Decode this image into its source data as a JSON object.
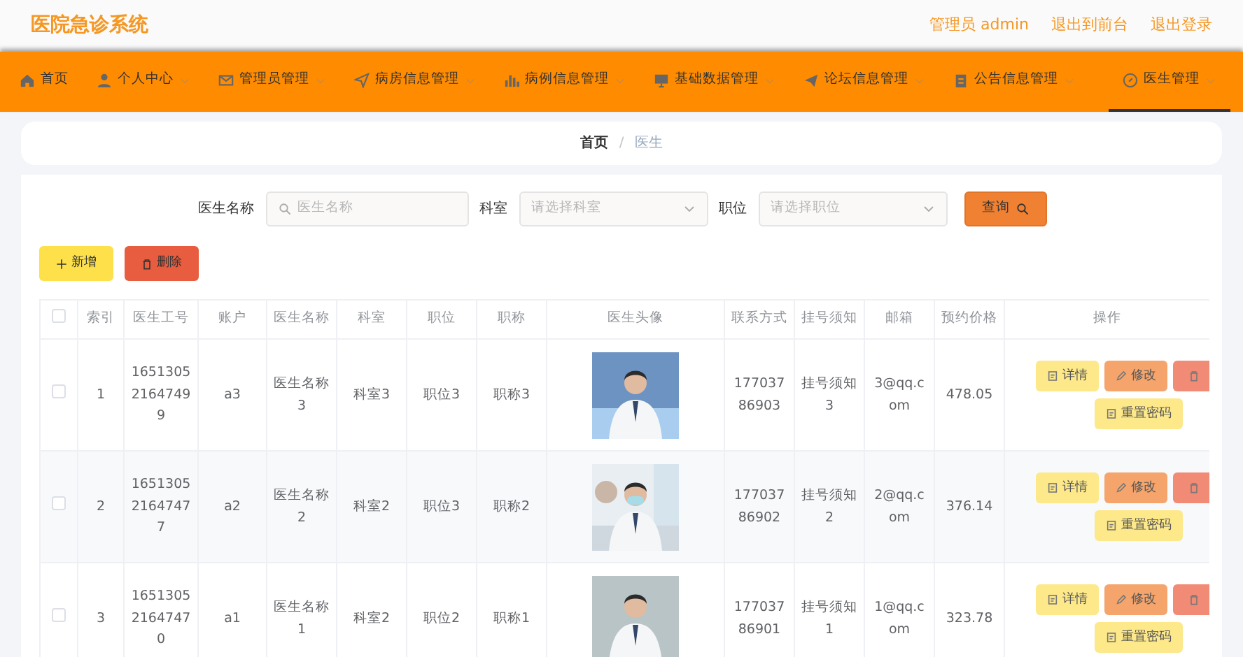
{
  "header": {
    "title": "医院急诊系统",
    "links": [
      "管理员 admin",
      "退出到前台",
      "退出登录"
    ]
  },
  "nav": [
    {
      "label": "首页",
      "expandable": false,
      "selected": false
    },
    {
      "label": "个人中心",
      "expandable": true,
      "selected": false
    },
    {
      "label": "管理员管理",
      "expandable": true,
      "selected": false
    },
    {
      "label": "病房信息管理",
      "expandable": true,
      "selected": false
    },
    {
      "label": "病例信息管理",
      "expandable": true,
      "selected": false
    },
    {
      "label": "基础数据管理",
      "expandable": true,
      "selected": false
    },
    {
      "label": "论坛信息管理",
      "expandable": true,
      "selected": false
    },
    {
      "label": "公告信息管理",
      "expandable": true,
      "selected": false
    },
    {
      "label": "医生管理",
      "expandable": true,
      "selected": true
    }
  ],
  "breadcrumb": {
    "items": [
      "首页",
      "医生"
    ],
    "separator": "/"
  },
  "search": {
    "fields": [
      {
        "kind": "text",
        "label": "医生名称",
        "placeholder": "医生名称"
      },
      {
        "kind": "select",
        "label": "科室",
        "placeholder": "请选择科室"
      },
      {
        "kind": "select",
        "label": "职位",
        "placeholder": "请选择职位"
      }
    ],
    "button": "查询"
  },
  "actions": [
    {
      "kind": "add",
      "label": "新增"
    },
    {
      "kind": "delete",
      "label": "删除"
    }
  ],
  "table": {
    "select_all_checked": false,
    "columns": [
      "索引",
      "医生工号",
      "账户",
      "医生名称",
      "科室",
      "职位",
      "职称",
      "医生头像",
      "联系方式",
      "挂号须知",
      "邮箱",
      "预约价格",
      "操作"
    ],
    "rows": [
      {
        "checked": false,
        "cells": [
          "1",
          "165130521647499",
          "a3",
          "医生名称3",
          "科室3",
          "职位3",
          "职称3"
        ],
        "cells2": [
          "17703786903",
          "挂号须知3",
          "3@qq.com",
          "478.05"
        ],
        "buttons": [
          {
            "kind": "detail",
            "label": "详情"
          },
          {
            "kind": "edit",
            "label": "修改"
          },
          {
            "kind": "delete"
          },
          {
            "kind": "reset",
            "label": "重置密码"
          }
        ]
      },
      {
        "checked": false,
        "cells": [
          "2",
          "165130521647477",
          "a2",
          "医生名称2",
          "科室2",
          "职位3",
          "职称2"
        ],
        "cells2": [
          "17703786902",
          "挂号须知2",
          "2@qq.com",
          "376.14"
        ],
        "buttons": [
          {
            "kind": "detail",
            "label": "详情"
          },
          {
            "kind": "edit",
            "label": "修改"
          },
          {
            "kind": "delete"
          },
          {
            "kind": "reset",
            "label": "重置密码"
          }
        ]
      },
      {
        "checked": false,
        "cells": [
          "3",
          "165130521647470",
          "a1",
          "医生名称1",
          "科室2",
          "职位2",
          "职称1"
        ],
        "cells2": [
          "17703786901",
          "挂号须知1",
          "1@qq.com",
          "323.78"
        ],
        "buttons": [
          {
            "kind": "detail",
            "label": "详情"
          },
          {
            "kind": "edit",
            "label": "修改"
          },
          {
            "kind": "delete"
          },
          {
            "kind": "reset",
            "label": "重置密码"
          }
        ]
      }
    ]
  }
}
